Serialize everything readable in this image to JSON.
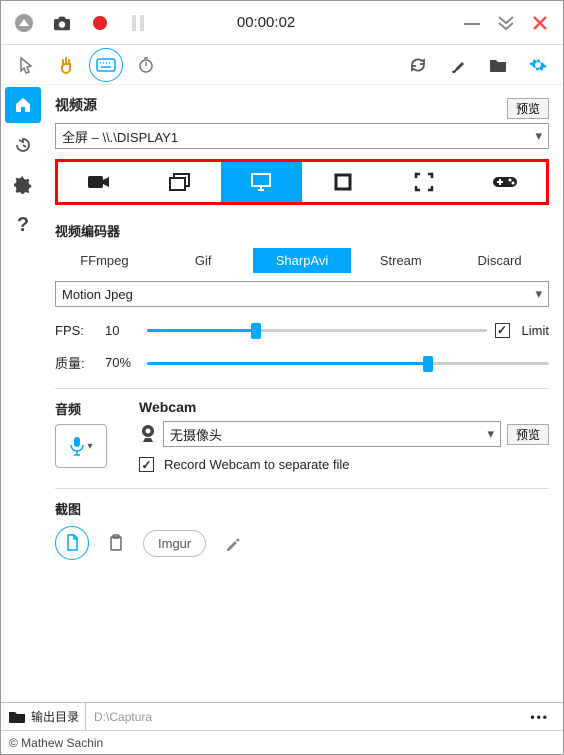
{
  "timer": "00:00:02",
  "colors": {
    "accent": "#00a8ff",
    "record": "#e62424",
    "close": "#ff4a4a"
  },
  "video_source": {
    "heading": "视频源",
    "preview_btn": "预览",
    "selected": "全屏 – \\\\.\\DISPLAY1",
    "types": [
      "camera",
      "windows",
      "monitor",
      "region",
      "fullscreen",
      "game"
    ],
    "types_icon_names": [
      "camera-icon",
      "windows-icon",
      "monitor-icon",
      "region-icon",
      "fullscreen-icon",
      "gamepad-icon"
    ],
    "selected_type_index": 2
  },
  "encoder": {
    "heading": "视频编码器",
    "tabs": [
      "FFmpeg",
      "Gif",
      "SharpAvi",
      "Stream",
      "Discard"
    ],
    "selected_index": 2,
    "codec_selected": "Motion Jpeg"
  },
  "fps": {
    "label": "FPS:",
    "value": "10",
    "limit_checked": true,
    "limit_label": "Limit",
    "percent": 32
  },
  "quality": {
    "label": "质量:",
    "value": "70%",
    "percent": 70
  },
  "audio": {
    "heading": "音频",
    "mic_on": true
  },
  "webcam": {
    "heading": "Webcam",
    "selected": "无摄像头",
    "preview_btn": "预览",
    "sep_file_checked": true,
    "sep_file_label": "Record Webcam to separate file"
  },
  "screenshot": {
    "heading": "截图",
    "imgur_label": "Imgur"
  },
  "footer": {
    "out_label": "输出目录",
    "out_path_placeholder": "D:\\Captura",
    "copyright": "© Mathew Sachin"
  }
}
